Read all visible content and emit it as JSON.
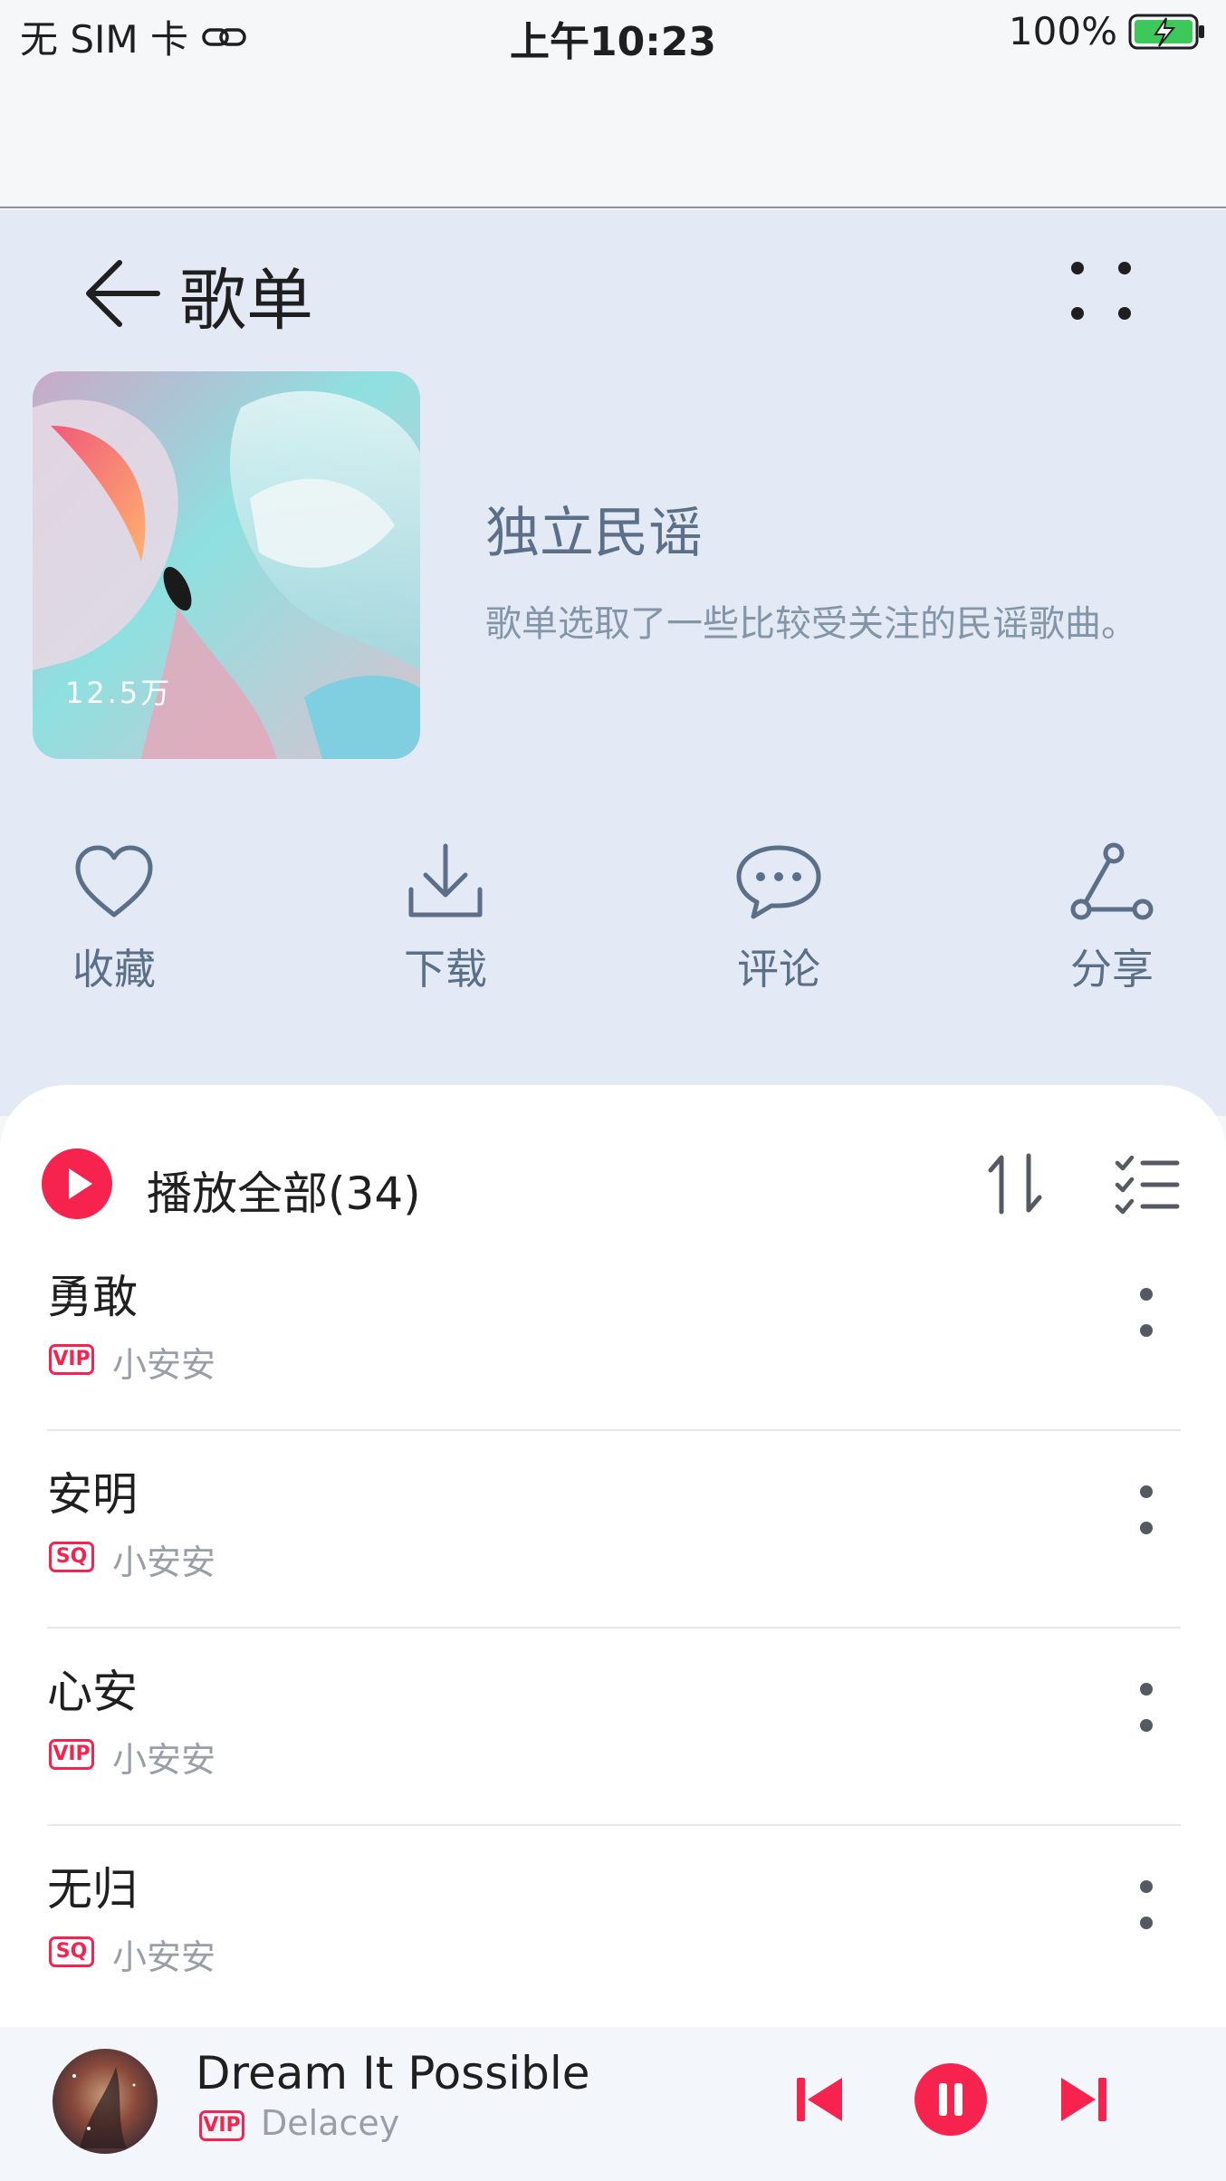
{
  "status_bar": {
    "carrier": "无 SIM 卡",
    "time": "上午10:23",
    "battery": "100%"
  },
  "header": {
    "title": "歌单"
  },
  "playlist": {
    "cover_count": "12.5万",
    "name": "独立民谣",
    "description": "歌单选取了一些比较受关注的民谣歌曲。"
  },
  "actions": [
    {
      "label": "收藏",
      "icon": "heart-icon"
    },
    {
      "label": "下载",
      "icon": "download-icon"
    },
    {
      "label": "评论",
      "icon": "comment-icon"
    },
    {
      "label": "分享",
      "icon": "share-icon"
    }
  ],
  "list_header": {
    "play_all_label": "播放全部(34)"
  },
  "songs": [
    {
      "title": "勇敢",
      "badge": "VIP",
      "artist": "小安安"
    },
    {
      "title": "安明",
      "badge": "SQ",
      "artist": "小安安"
    },
    {
      "title": "心安",
      "badge": "VIP",
      "artist": "小安安"
    },
    {
      "title": "无归",
      "badge": "SQ",
      "artist": "小安安"
    }
  ],
  "mini_player": {
    "title": "Dream It Possible",
    "badge": "VIP",
    "artist": "Delacey"
  },
  "colors": {
    "accent": "#f7234f",
    "hero_bg": "#e3eaf6",
    "action_color": "#5b6f88"
  }
}
